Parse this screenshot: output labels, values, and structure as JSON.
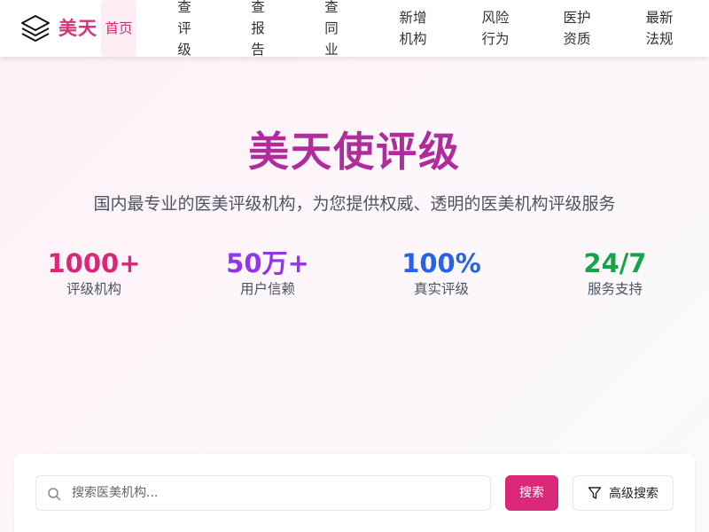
{
  "header": {
    "logo_text": "美天",
    "logo_icon": "layers-icon",
    "nav": [
      {
        "label": "首页",
        "active": true
      },
      {
        "label": "查评级"
      },
      {
        "label": "查报告"
      },
      {
        "label": "查同业"
      },
      {
        "label": "新增机构"
      },
      {
        "label": "风险行为"
      },
      {
        "label": "医护资质"
      },
      {
        "label": "最新法规"
      }
    ]
  },
  "hero": {
    "title": "美天使评级",
    "subtitle": "国内最专业的医美评级机构，为您提供权威、透明的医美机构评级服务",
    "stats": [
      {
        "value": "1000+",
        "label": "评级机构",
        "color": "#db2777"
      },
      {
        "value": "50万+",
        "label": "用户信赖",
        "color": "#9333ea"
      },
      {
        "value": "100%",
        "label": "真实评级",
        "color": "#2563eb"
      },
      {
        "value": "24/7",
        "label": "服务支持",
        "color": "#16a34a"
      }
    ]
  },
  "search": {
    "placeholder": "搜索医美机构...",
    "value": "",
    "button_label": "搜索",
    "advanced_label": "高级搜索",
    "search_icon": "search-icon",
    "filter_icon": "filter-icon"
  },
  "colors": {
    "accent": "#db2777",
    "title": "#b02c9c"
  }
}
